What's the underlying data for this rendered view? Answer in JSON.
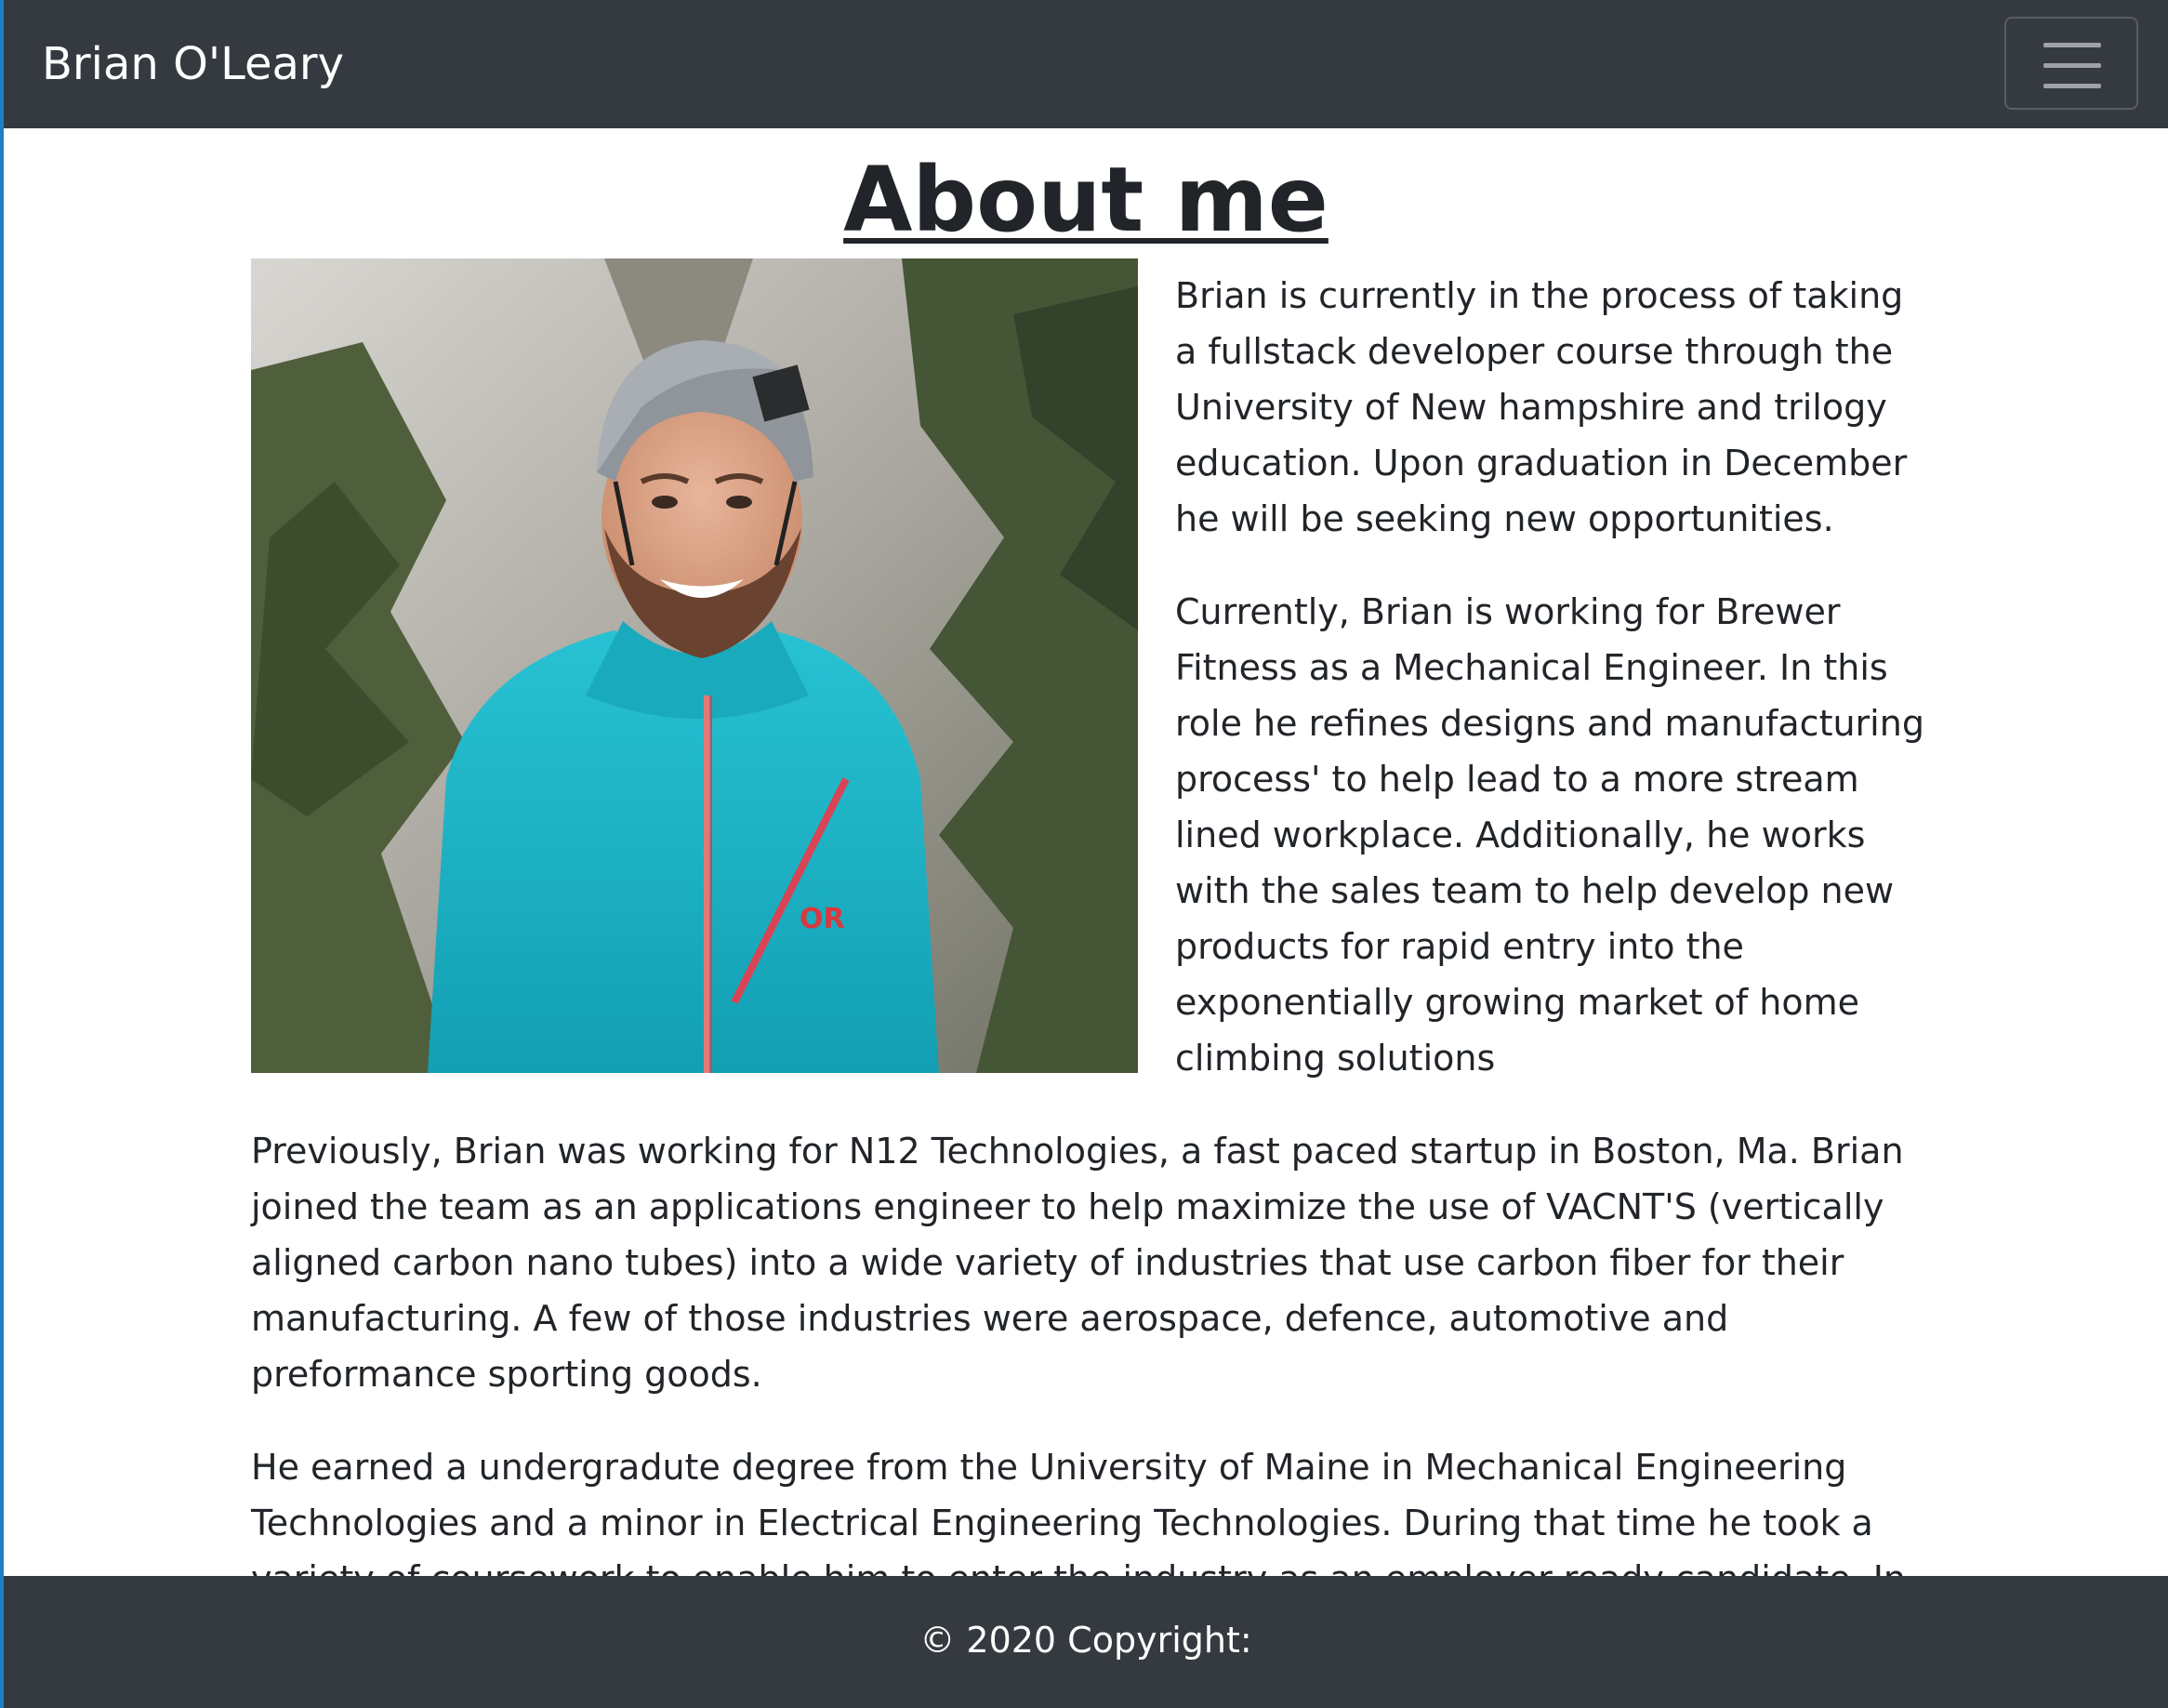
{
  "navbar": {
    "brand": "Brian O'Leary",
    "toggler_icon": "hamburger-menu-icon"
  },
  "main": {
    "title": "About me",
    "photo_description_icon": "profile-photo",
    "paragraphs": [
      "Brian is currently in the process of taking a fullstack developer course through the University of New hampshire and trilogy education. Upon graduation in December he will be seeking new opportunities.",
      "Currently, Brian is working for Brewer Fitness as a Mechanical Engineer. In this role he refines designs and manufacturing process' to help lead to a more stream lined workplace. Additionally, he works with the sales team to help develop new products for rapid entry into the exponentially growing market of home climbing solutions",
      "Previously, Brian was working for N12 Technologies, a fast paced startup in Boston, Ma. Brian joined the team as an applications engineer to help maximize the use of VACNT'S (vertically aligned carbon nano tubes) into a wide variety of industries that use carbon fiber for their manufacturing. A few of those industries were aerospace, defence, automotive and preformance sporting goods.",
      "He earned a undergradute degree from the University of Maine in Mechanical Engineering Technologies and a minor in Electrical Engineering Technologies. During that time he took a variety of coursework to enable him to enter the industry as an employer ready candidate. In the time that Brian wasn't focused on acidemics he focused on his development as an outdoor educator. He believes that"
    ]
  },
  "footer": {
    "copyright": "© 2020 Copyright:"
  },
  "colors": {
    "navbar_bg": "#343a40",
    "footer_bg": "#343a40",
    "text": "#212529",
    "jacket": "#1fb4c8",
    "helmet": "#8e9499"
  }
}
